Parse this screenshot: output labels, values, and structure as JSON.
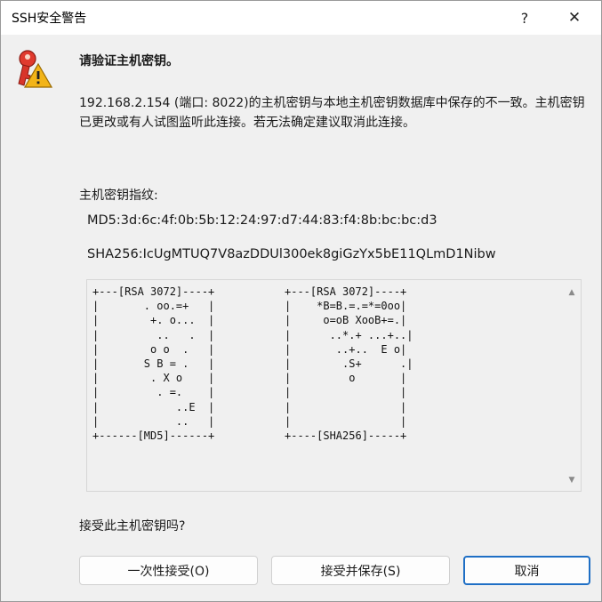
{
  "window": {
    "title": "SSH安全警告",
    "help_glyph": "?",
    "close_glyph": "✕"
  },
  "icon": "key-warning-icon",
  "heading": "请验证主机密钥。",
  "message": "192.168.2.154 (端口: 8022)的主机密钥与本地主机密钥数据库中保存的不一致。主机密钥已更改或有人试图监听此连接。若无法确定建议取消此连接。",
  "fingerprint": {
    "label": "主机密钥指纹:",
    "md5": "MD5:3d:6c:4f:0b:5b:12:24:97:d7:44:83:f4:8b:bc:bc:d3",
    "sha256": "SHA256:IcUgMTUQ7V8azDDUl300ek8giGzYx5bE11QLmD1Nibw"
  },
  "randomart": {
    "md5": "+---[RSA 3072]----+\n|       . oo.=+   |\n|        +. o...  |\n|         ..   .  |\n|        o o  .   |\n|       S B = .   |\n|        . X o    |\n|         . =.    |\n|            ..E  |\n|            ..   |\n+------[MD5]------+",
    "sha256": "+---[RSA 3072]----+\n|    *B=B.=.=*=0oo|\n|     o=oB XooB+=.|\n|      ..*.+ ...+..|\n|       ..+..  E o|\n|        .S+      .|\n|         o       |\n|                 |\n|                 |\n|                 |\n+----[SHA256]-----+"
  },
  "question": "接受此主机密钥吗?",
  "buttons": {
    "accept_once": "一次性接受(O)",
    "accept_save": "接受并保存(S)",
    "cancel": "取消"
  },
  "colors": {
    "default_button_border": "#1f6fc5"
  }
}
